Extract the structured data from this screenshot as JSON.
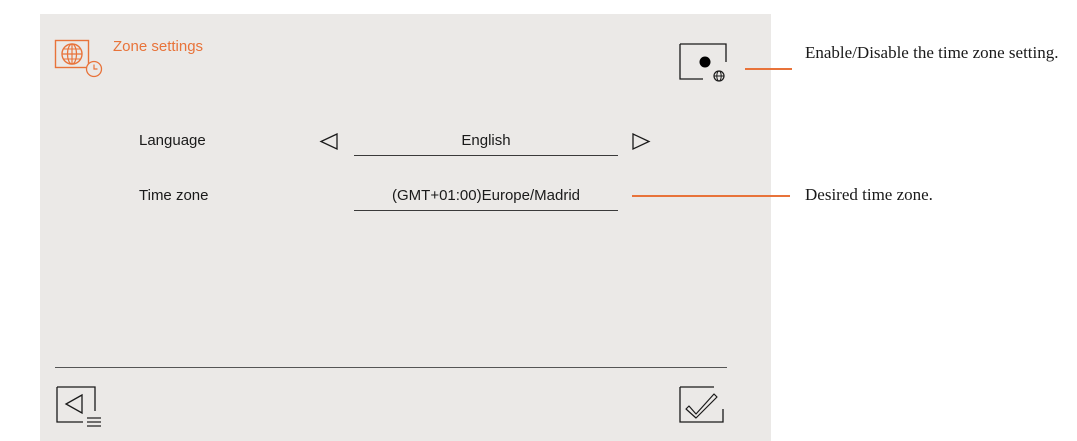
{
  "header": {
    "title": "Zone settings",
    "icon": "globe-clock-icon"
  },
  "toggle": {
    "icon": "toggle-globe-icon"
  },
  "rows": {
    "language": {
      "label": "Language",
      "value": "English",
      "prev_icon": "triangle-left-icon",
      "next_icon": "triangle-right-icon"
    },
    "timezone": {
      "label": "Time zone",
      "value": "(GMT+01:00)Europe/Madrid"
    }
  },
  "footer": {
    "back_icon": "back-icon",
    "confirm_icon": "checkmark-icon"
  },
  "annotations": {
    "toggle_note": "Enable/Disable the time zone setting.",
    "timezone_note": "Desired time zone."
  },
  "colors": {
    "accent": "#e8733a",
    "panel": "#ebe9e7",
    "text": "#1a1a1a"
  }
}
